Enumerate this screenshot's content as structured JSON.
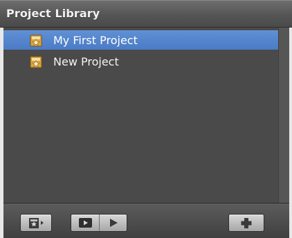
{
  "library": {
    "title": "Project Library",
    "projects": [
      {
        "label": "My First Project",
        "selected": true,
        "icon": "project-icon"
      },
      {
        "label": "New Project",
        "selected": false,
        "icon": "project-icon"
      }
    ]
  },
  "toolbar": {
    "icons": [
      "project-properties-icon",
      "play-full-screen-icon",
      "play-icon",
      "add-icon"
    ]
  },
  "colors": {
    "selection": "#4a7bc6",
    "list_background": "#4a4a4a",
    "header_text": "#f2f2f2"
  }
}
